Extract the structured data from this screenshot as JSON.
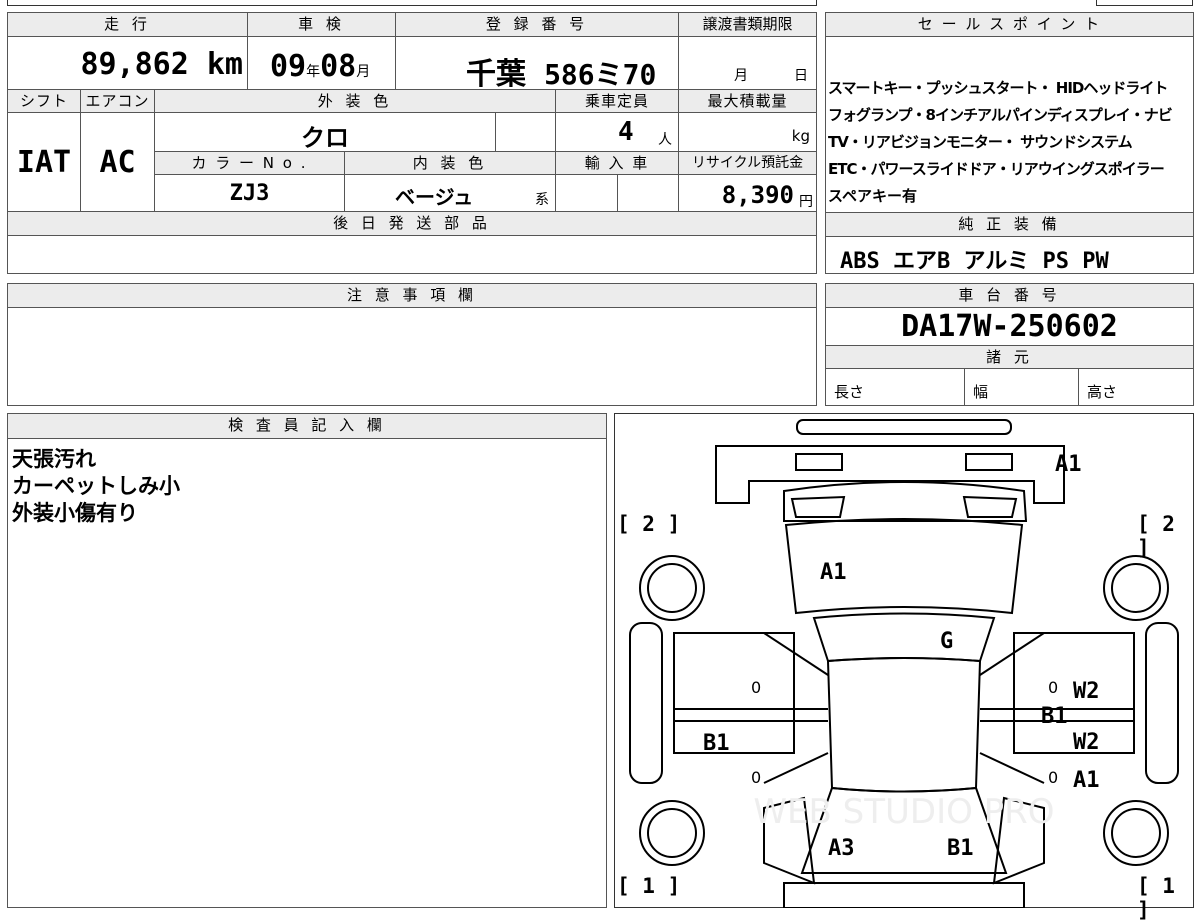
{
  "left": {
    "headers": {
      "mileage": "走 行",
      "inspection": "車 検",
      "registration": "登 録 番 号",
      "transfer_deadline": "譲渡書類期限",
      "shift": "シフト",
      "aircon": "エアコン",
      "exterior_color": "外 装 色",
      "capacity": "乗車定員",
      "max_load": "最大積載量",
      "color_no": "カ ラ ー N o .",
      "interior_color": "内 装 色",
      "import": "輸 入 車",
      "recycle": "リサイクル預託金"
    },
    "mileage": {
      "value": "89,862",
      "unit": "km"
    },
    "inspection": {
      "year": "09",
      "year_unit": "年",
      "month": "08",
      "month_unit": "月"
    },
    "registration": {
      "region": "千葉",
      "number": "586ミ70"
    },
    "transfer": {
      "month_unit": "月",
      "day_unit": "日"
    },
    "shift_value": "IAT",
    "aircon_value": "AC",
    "exterior_color_value": "クロ",
    "capacity": {
      "value": "4",
      "unit": "人"
    },
    "max_load_unit": "kg",
    "color_no_value": "ZJ3",
    "interior_color": {
      "value": "ベージュ",
      "suffix": "系"
    },
    "recycle": {
      "value": "8,390",
      "unit": "円"
    },
    "later_parts_header": "後 日 発 送 部 品",
    "notes_header": "注 意 事 項 欄",
    "inspector_header": "検 査 員 記 入 欄",
    "inspector_lines": [
      "天張汚れ",
      "カーペットしみ小",
      "外装小傷有り"
    ]
  },
  "right": {
    "sales_header": "セ ー ル ス ポ イ ン ト",
    "sales_lines": [
      "スマートキー・プッシュスタート・ HIDヘッドライト",
      "フォグランプ・8インチアルパインディスプレイ・ナビ",
      "TV・リアビジョンモニター・ サウンドシステム",
      "ETC・パワースライドドア・リアウイングスポイラー",
      "スペアキー有"
    ],
    "equipment_header": "純 正 装 備",
    "equipment_value": "ABS エアB アルミ PS PW",
    "chassis_header": "車 台 番 号",
    "chassis_value": "DA17W-250602",
    "specs_header": "諸 元",
    "specs": {
      "length": "長さ",
      "width": "幅",
      "height": "高さ"
    }
  },
  "diagram": {
    "watermark": "WEB STUDIO PRO",
    "labels": {
      "front_top": "A1",
      "hood": "A1",
      "roof": "G",
      "right_front_door": "W2",
      "right_b1": "B1",
      "right_rear_door": "W2",
      "right_rear_a1": "A1",
      "left_b1": "B1",
      "rear_left": "A3",
      "rear_right": "B1",
      "zero1": "0",
      "zero2": "0",
      "zero3": "0",
      "zero4": "0"
    },
    "brackets": {
      "top_left": "[ 2 ]",
      "top_right": "[ 2 ]",
      "bottom_left": "[ 1 ]",
      "bottom_right": "[ 1 ]"
    }
  }
}
